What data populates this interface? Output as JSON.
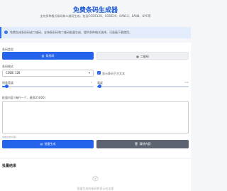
{
  "header": {
    "title": "免费条码生成器",
    "subtitle": "支持多种格式条码和二维码生成，包括CODE128、CODE39、EAN13、EAN8、UPC等"
  },
  "notice": {
    "icon": "info-icon",
    "text": "免费生成条形码或二维码，支持条形码和二维码批量生成，提供多种格式选择，可直接下载使用。"
  },
  "form": {
    "type_label": "条码类型",
    "type_options": [
      {
        "label": "条形码",
        "icon": "barcode-icon",
        "active": true
      },
      {
        "label": "二维码",
        "icon": "qrcode-icon",
        "active": false
      }
    ],
    "format_label": "条码格式",
    "format_value": "CODE 128",
    "show_text_label": "显示条码下方文本",
    "show_text_checked": true,
    "width_label": "线条宽度",
    "width_min": "1",
    "width_max": "5",
    "width_fraction": 0.05,
    "height_label": "高度",
    "height_min": "20",
    "height_max": "150",
    "height_fraction": 0.02,
    "content_label": "批量内容 (每行一个，最多25000)",
    "content_placeholder": "",
    "count_text": "当前生成0条码",
    "generate_label": "批量生成",
    "clear_label": "清除内容"
  },
  "results": {
    "title": "批量结果",
    "empty_icon": "box-icon",
    "empty_text": "批量生成的条码将显示在这里"
  },
  "colors": {
    "accent": "#2563eb",
    "title": "#1e5bd8",
    "secondary_button": "#5b6470"
  }
}
